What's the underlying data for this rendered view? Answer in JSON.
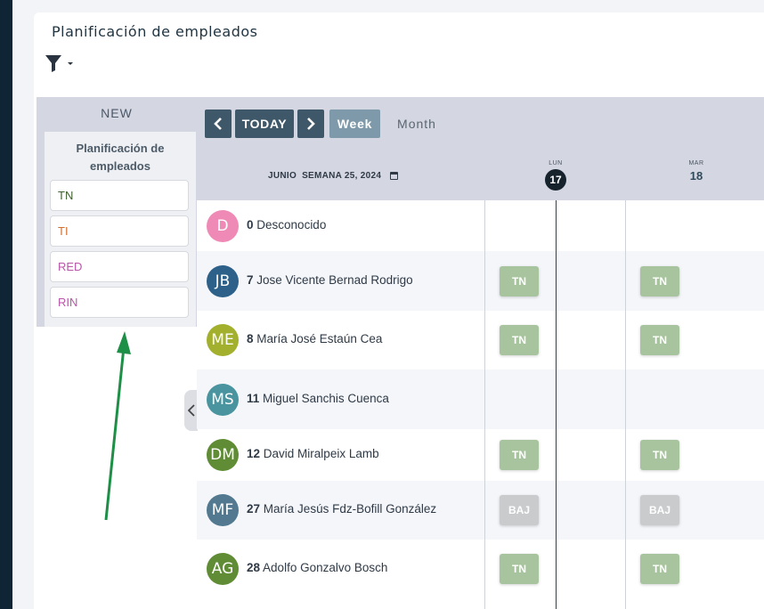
{
  "header": {
    "title": "Planificación de empleados"
  },
  "toolbar": {
    "today_label": "TODAY",
    "week_label": "Week",
    "month_label": "Month",
    "month_name": "JUNIO",
    "week_text": "SEMANA 25, 2024"
  },
  "days": [
    {
      "name": "LUN",
      "num": "17",
      "today": true
    },
    {
      "name": "MAR",
      "num": "18",
      "today": false
    }
  ],
  "sidebar": {
    "new_label": "NEW",
    "panel_title": "Planificación de empleados",
    "chips": [
      {
        "label": "TN",
        "color": "#3e5f2e"
      },
      {
        "label": "TI",
        "color": "#d07030"
      },
      {
        "label": "RED",
        "color": "#b856a8"
      },
      {
        "label": "RIN",
        "color": "#b856a8"
      }
    ]
  },
  "employees": [
    {
      "initials": "D",
      "num": "0",
      "name": "Desconocido",
      "avatar_color": "#ef8ab6",
      "shifts": [
        "",
        ""
      ]
    },
    {
      "initials": "JB",
      "num": "7",
      "name": "Jose Vicente Bernad Rodrigo",
      "avatar_color": "#2e6189",
      "shifts": [
        "TN",
        "TN"
      ]
    },
    {
      "initials": "ME",
      "num": "8",
      "name": "María José Estaún Cea",
      "avatar_color": "#a2b02e",
      "shifts": [
        "TN",
        "TN"
      ]
    },
    {
      "initials": "MS",
      "num": "11",
      "name": "Miguel Sanchis Cuenca",
      "avatar_color": "#49949e",
      "shifts": [
        "",
        ""
      ]
    },
    {
      "initials": "DM",
      "num": "12",
      "name": "David Miralpeix Lamb",
      "avatar_color": "#5f8c35",
      "shifts": [
        "TN",
        "TN"
      ]
    },
    {
      "initials": "MF",
      "num": "27",
      "name": "María Jesús Fdz-Bofill González",
      "avatar_color": "#52798f",
      "shifts": [
        "BAJ",
        "BAJ"
      ]
    },
    {
      "initials": "AG",
      "num": "28",
      "name": "Adolfo Gonzalvo Bosch",
      "avatar_color": "#5f8c35",
      "shifts": [
        "TN",
        "TN"
      ]
    }
  ],
  "shift_colors": {
    "TN": "#a8c49e",
    "BAJ": "#c9cbcd"
  }
}
